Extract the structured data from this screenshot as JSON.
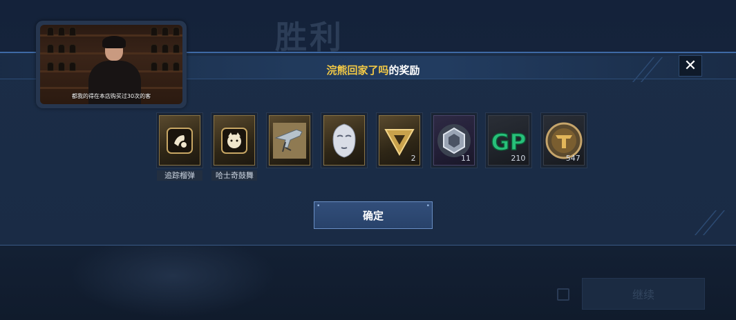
{
  "background": {
    "title": "胜利",
    "continue_label": "继续"
  },
  "dialog": {
    "title_highlight": "浣熊回家了吗",
    "title_suffix": "的奖励",
    "confirm_label": "确定",
    "close_glyph": "✕"
  },
  "video": {
    "caption": "都我的得在本店购买过30次的客"
  },
  "rewards": [
    {
      "name": "追踪榴弹",
      "qty": "",
      "icon": "grenade-emblem-icon",
      "rarity": "gold"
    },
    {
      "name": "哈士奇鼓舞",
      "qty": "",
      "icon": "husky-emblem-icon",
      "rarity": "gold"
    },
    {
      "name": "",
      "qty": "",
      "icon": "weapon-skin-icon",
      "rarity": "gold"
    },
    {
      "name": "",
      "qty": "",
      "icon": "mask-icon",
      "rarity": "gold"
    },
    {
      "name": "",
      "qty": "2",
      "icon": "triangle-token-icon",
      "rarity": "gold"
    },
    {
      "name": "",
      "qty": "11",
      "icon": "hex-badge-icon",
      "rarity": "purple"
    },
    {
      "name": "",
      "qty": "210",
      "icon": "gp-coin-icon",
      "rarity": "dark"
    },
    {
      "name": "",
      "qty": "547",
      "icon": "gold-medal-icon",
      "rarity": "dark"
    }
  ],
  "colors": {
    "highlight": "#f3c945",
    "panel": "#1b2d47",
    "accent": "#3e6aa6"
  }
}
